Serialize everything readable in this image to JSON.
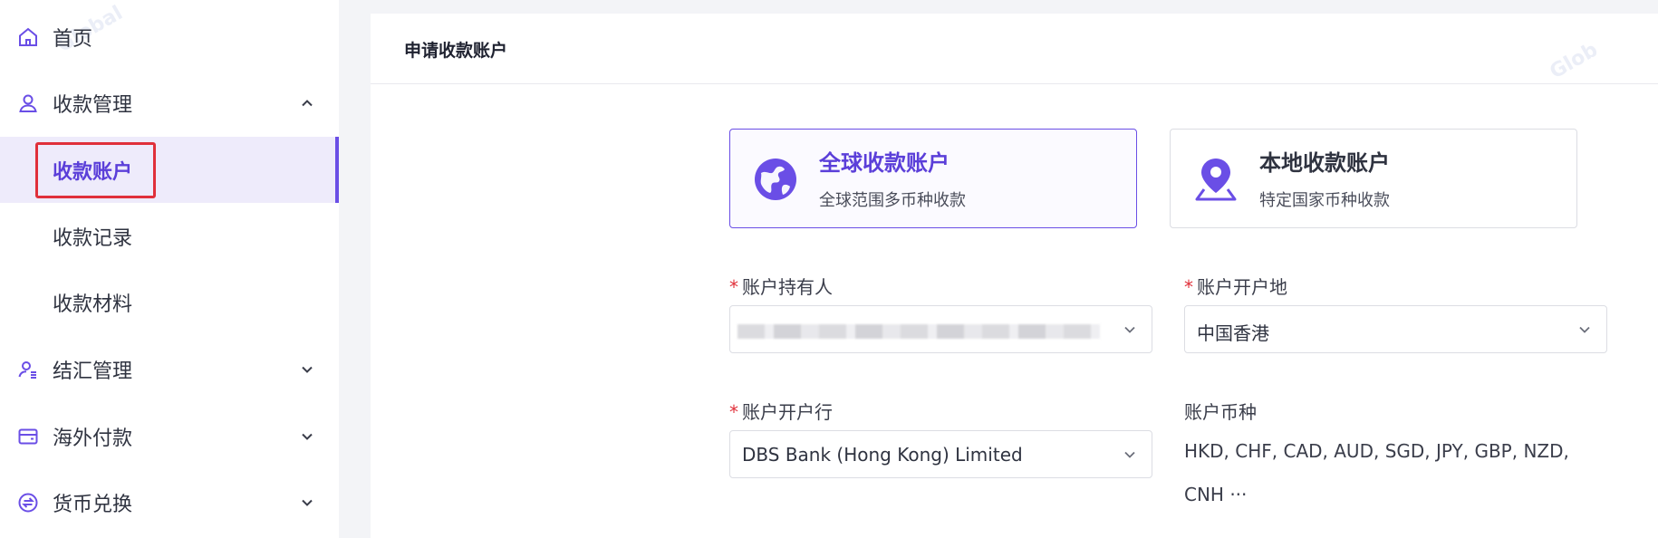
{
  "sidebar": {
    "items": [
      {
        "label": "首页",
        "icon": "home-icon"
      },
      {
        "label": "收款管理",
        "icon": "user-icon",
        "expanded": true,
        "children": [
          {
            "label": "收款账户",
            "active": true
          },
          {
            "label": "收款记录"
          },
          {
            "label": "收款材料"
          }
        ]
      },
      {
        "label": "结汇管理",
        "icon": "user-list-icon"
      },
      {
        "label": "海外付款",
        "icon": "wallet-icon"
      },
      {
        "label": "货币兑换",
        "icon": "exchange-icon"
      }
    ]
  },
  "main": {
    "title": "申请收款账户",
    "cards": [
      {
        "title": "全球收款账户",
        "subtitle": "全球范围多币种收款",
        "selected": true,
        "icon": "globe-icon"
      },
      {
        "title": "本地收款账户",
        "subtitle": "特定国家币种收款",
        "selected": false,
        "icon": "location-pin-icon"
      }
    ],
    "fields": {
      "holder": {
        "label": "账户持有人",
        "required": "*",
        "value": ""
      },
      "region": {
        "label": "账户开户地",
        "required": "*",
        "value": "中国香港"
      },
      "bank": {
        "label": "账户开户行",
        "required": "*",
        "value": "DBS Bank (Hong Kong) Limited"
      },
      "currency": {
        "label": "账户币种",
        "value": "HKD, CHF, CAD, AUD, SGD, JPY, GBP, NZD, CNH ···"
      }
    }
  },
  "colors": {
    "accent": "#6a4ee6",
    "active_bg": "#eeebfb",
    "highlight": "#e0303a",
    "required": "#e0303a"
  }
}
